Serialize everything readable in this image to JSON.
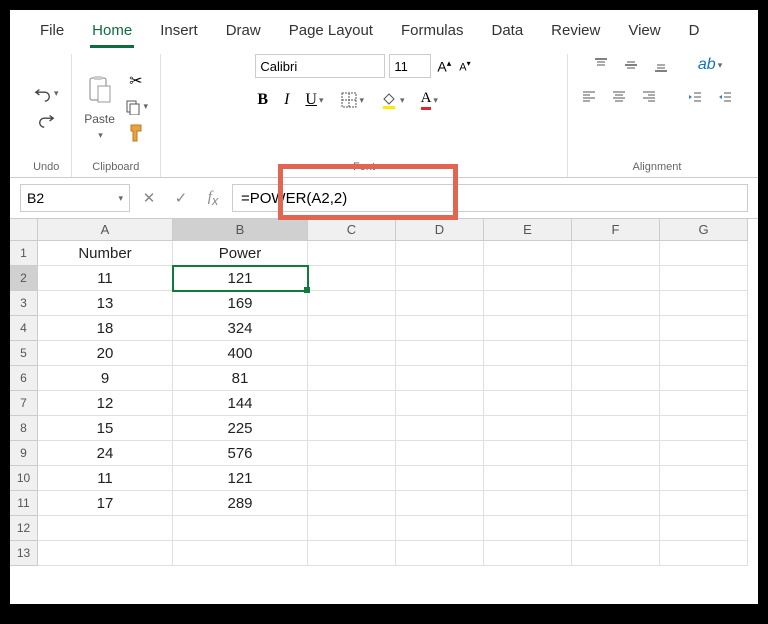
{
  "tabs": [
    "File",
    "Home",
    "Insert",
    "Draw",
    "Page Layout",
    "Formulas",
    "Data",
    "Review",
    "View",
    "D"
  ],
  "active_tab": "Home",
  "groups": {
    "undo": "Undo",
    "clipboard": "Clipboard",
    "font": "Font",
    "alignment": "Alignment"
  },
  "paste_label": "Paste",
  "font": {
    "name": "Calibri",
    "size": "11",
    "bold": "B",
    "italic": "I",
    "underline": "U"
  },
  "namebox": "B2",
  "formula": "=POWER(A2,2)",
  "columns": [
    "A",
    "B",
    "C",
    "D",
    "E",
    "F",
    "G"
  ],
  "colwidths": [
    "wA",
    "wB",
    "wR",
    "wR",
    "wR",
    "wR",
    "wR"
  ],
  "rows": [
    "1",
    "2",
    "3",
    "4",
    "5",
    "6",
    "7",
    "8",
    "9",
    "10",
    "11",
    "12",
    "13"
  ],
  "selected_cell": {
    "row": 2,
    "col": "B"
  },
  "data": {
    "A": {
      "1": "Number",
      "2": "11",
      "3": "13",
      "4": "18",
      "5": "20",
      "6": "9",
      "7": "12",
      "8": "15",
      "9": "24",
      "10": "11",
      "11": "17"
    },
    "B": {
      "1": "Power",
      "2": "121",
      "3": "169",
      "4": "324",
      "5": "400",
      "6": "81",
      "7": "144",
      "8": "225",
      "9": "576",
      "10": "121",
      "11": "289"
    }
  }
}
